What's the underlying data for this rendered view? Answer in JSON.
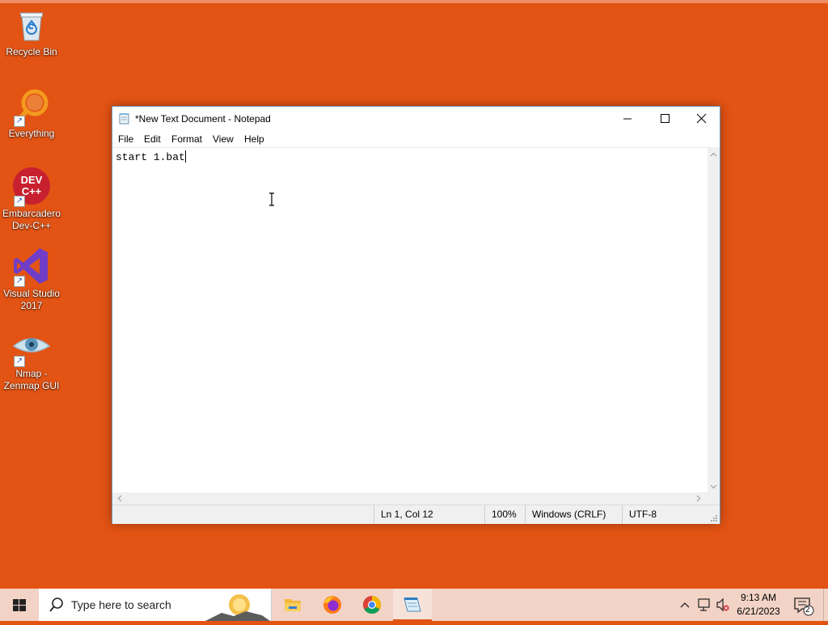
{
  "desktop": {
    "background_color": "#E35314",
    "icons": [
      {
        "label": "Recycle Bin",
        "icon": "recycle-bin-icon"
      },
      {
        "label": "Everything",
        "icon": "everything-search-icon"
      },
      {
        "label": "Embarcadero Dev-C++",
        "icon": "dev-cpp-icon",
        "icon_text": "DEV C++"
      },
      {
        "label": "Visual Studio 2017",
        "icon": "visual-studio-icon"
      },
      {
        "label": "Nmap - Zenmap GUI",
        "icon": "zenmap-eye-icon"
      }
    ]
  },
  "notepad": {
    "title": "*New Text Document - Notepad",
    "menu": [
      "File",
      "Edit",
      "Format",
      "View",
      "Help"
    ],
    "content": "start 1.bat",
    "status": {
      "position": "Ln 1, Col 12",
      "zoom": "100%",
      "line_ending": "Windows (CRLF)",
      "encoding": "UTF-8"
    }
  },
  "taskbar": {
    "search_placeholder": "Type here to search",
    "apps": [
      "file-explorer-icon",
      "firefox-icon",
      "chrome-icon",
      "notepad-icon"
    ],
    "active_app": "notepad-icon",
    "clock": {
      "time": "9:13 AM",
      "date": "6/21/2023"
    },
    "notification_count": "2",
    "accent_color": "#E35314"
  }
}
